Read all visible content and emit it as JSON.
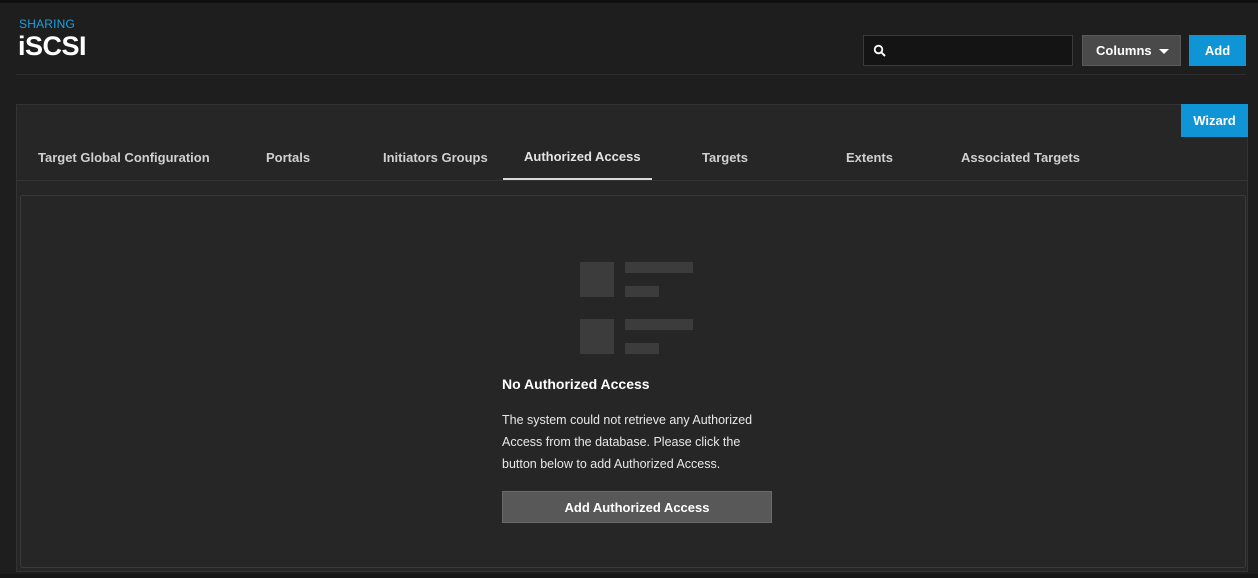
{
  "header": {
    "breadcrumb": "SHARING",
    "title": "iSCSI",
    "search": {
      "value": "",
      "placeholder": "",
      "icon": "search-icon"
    },
    "columns_label": "Columns",
    "add_label": "Add"
  },
  "card": {
    "wizard_label": "Wizard",
    "tabs": [
      {
        "label": "Target Global Configuration",
        "active": false
      },
      {
        "label": "Portals",
        "active": false
      },
      {
        "label": "Initiators Groups",
        "active": false
      },
      {
        "label": "Authorized Access",
        "active": true
      },
      {
        "label": "Targets",
        "active": false
      },
      {
        "label": "Extents",
        "active": false
      },
      {
        "label": "Associated Targets",
        "active": false
      }
    ]
  },
  "empty_state": {
    "icon": "empty-list-icon",
    "title": "No Authorized Access",
    "message": "The system could not retrieve any Authorized Access from the database. Please click the button below to add Authorized Access.",
    "button_label": "Add Authorized Access"
  },
  "colors": {
    "accent": "#0f95d6",
    "breadcrumb": "#1aa0e5",
    "background": "#1e1e1e",
    "card": "#262626"
  }
}
